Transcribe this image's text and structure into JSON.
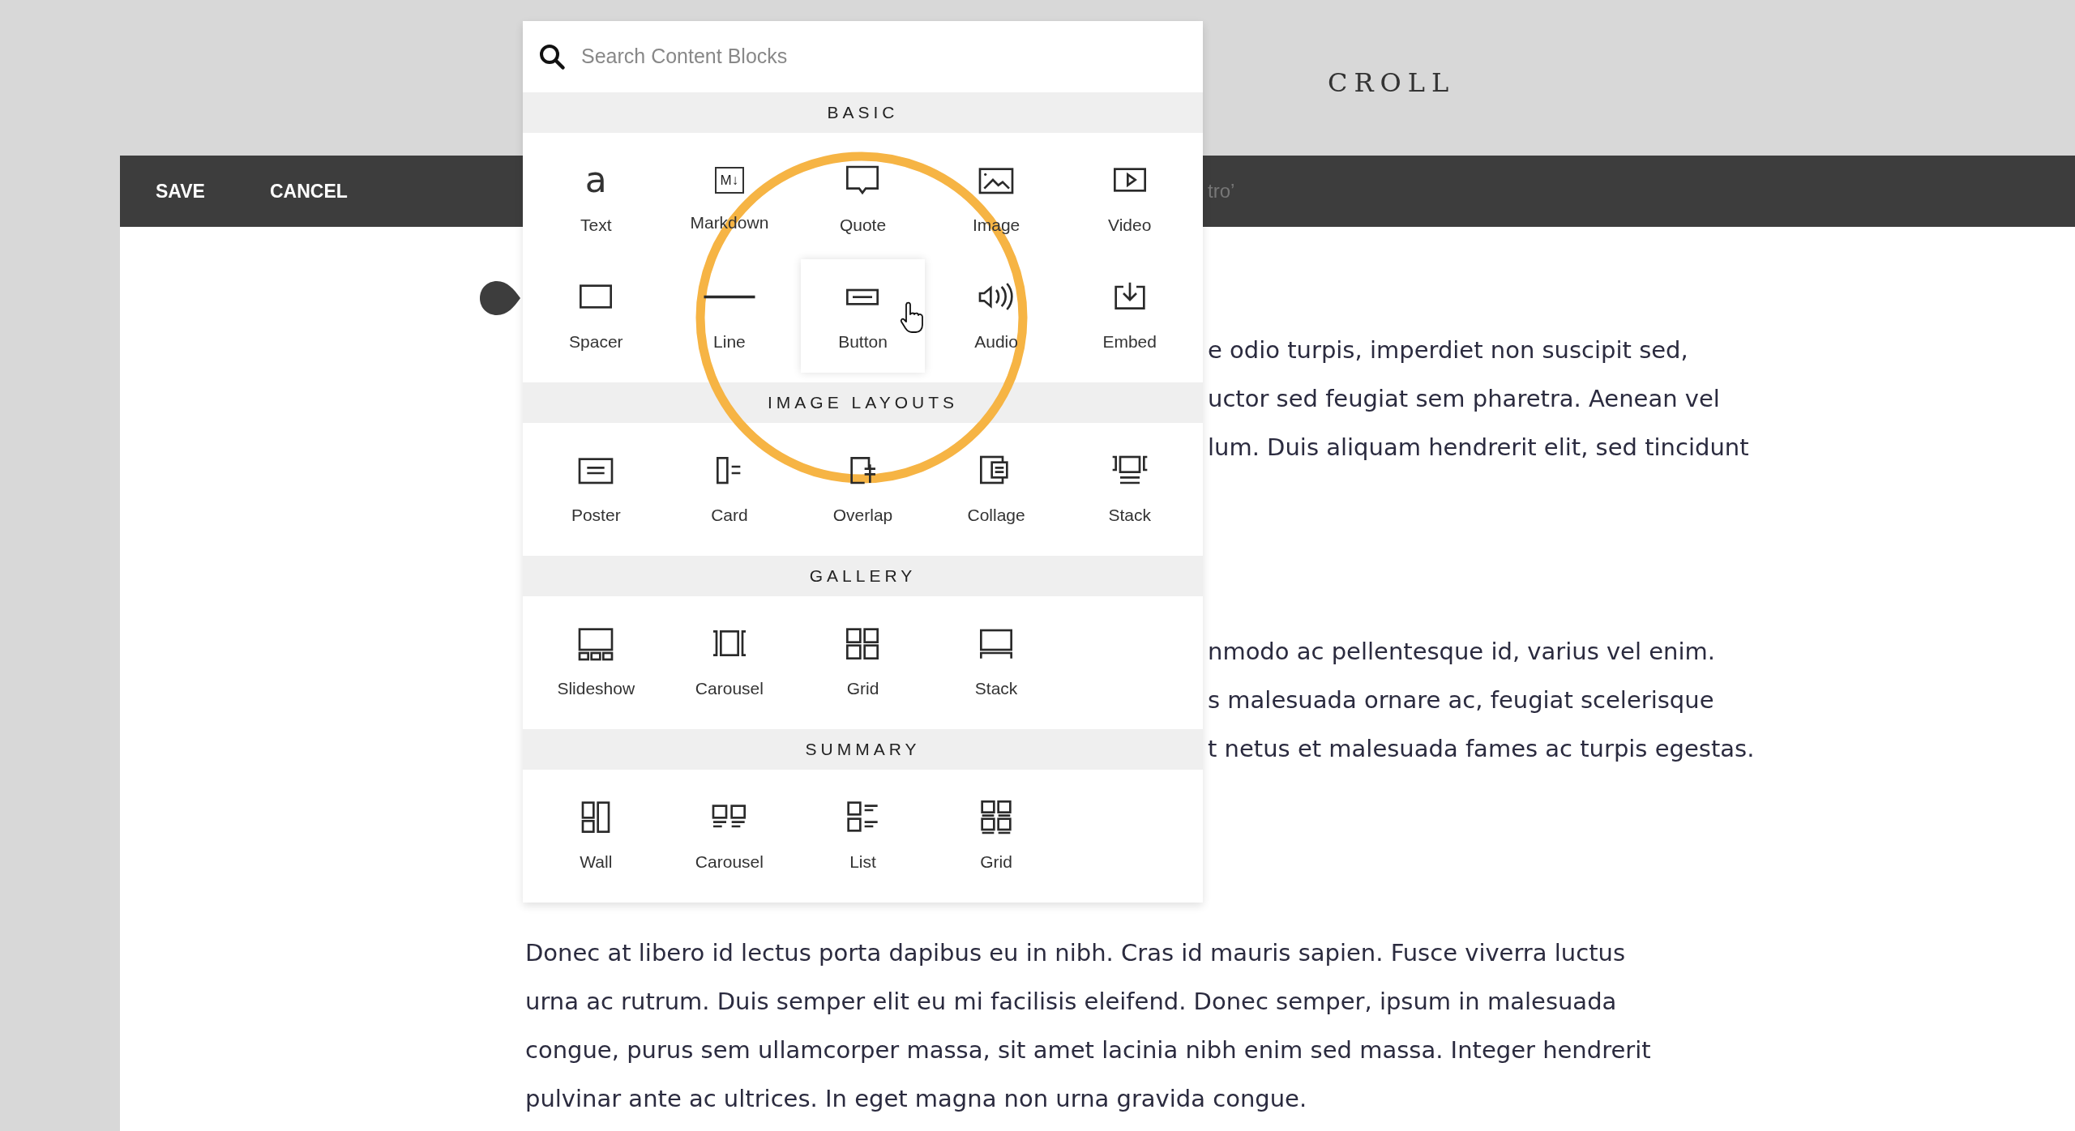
{
  "header": {
    "logo": "CROLL"
  },
  "toolbar": {
    "buttons": [
      "SAVE",
      "CANCEL"
    ],
    "title_fragment": "tro’"
  },
  "block_menu": {
    "search": {
      "placeholder": "Search Content Blocks"
    },
    "sections": [
      {
        "title": "BASIC",
        "items": [
          {
            "label": "Text",
            "glyph": "a",
            "selected": false
          },
          {
            "label": "Markdown",
            "glyph": "M↓",
            "selected": false
          },
          {
            "label": "Quote",
            "selected": false
          },
          {
            "label": "Image",
            "selected": false
          },
          {
            "label": "Video",
            "selected": false
          },
          {
            "label": "Spacer",
            "selected": false
          },
          {
            "label": "Line",
            "selected": false
          },
          {
            "label": "Button",
            "selected": true
          },
          {
            "label": "Audio",
            "selected": false
          },
          {
            "label": "Embed",
            "selected": false
          }
        ]
      },
      {
        "title": "IMAGE LAYOUTS",
        "items": [
          {
            "label": "Poster",
            "selected": false
          },
          {
            "label": "Card",
            "selected": false
          },
          {
            "label": "Overlap",
            "selected": false
          },
          {
            "label": "Collage",
            "selected": false
          },
          {
            "label": "Stack",
            "selected": false
          }
        ]
      },
      {
        "title": "GALLERY",
        "items": [
          {
            "label": "Slideshow",
            "selected": false
          },
          {
            "label": "Carousel",
            "selected": false
          },
          {
            "label": "Grid",
            "selected": false
          },
          {
            "label": "Stack",
            "selected": false
          }
        ]
      },
      {
        "title": "SUMMARY",
        "items": [
          {
            "label": "Wall",
            "selected": false
          },
          {
            "label": "Carousel",
            "selected": false
          },
          {
            "label": "List",
            "selected": false
          },
          {
            "label": "Grid",
            "selected": false
          }
        ]
      }
    ]
  },
  "paragraphs": [
    {
      "lines": [
        "e odio turpis, imperdiet non suscipit sed,",
        "uctor sed feugiat sem pharetra. Aenean vel",
        "lum. Duis aliquam hendrerit elit, sed tincidunt"
      ],
      "partial": true
    },
    {
      "lines": [
        "nmodo ac pellentesque id, varius vel enim.",
        "s malesuada ornare ac, feugiat scelerisque",
        "t netus et malesuada fames ac turpis egestas."
      ],
      "partial": true
    },
    {
      "lines": [
        "Donec at libero id lectus porta dapibus eu in nibh. Cras id mauris sapien. Fusce viverra luctus",
        "urna ac rutrum. Duis semper elit eu mi facilisis eleifend. Donec semper, ipsum in malesuada",
        "congue, purus sem ullamcorper massa, sit amet lacinia nibh enim sed massa. Integer hendrerit",
        "pulvinar ante ac ultrices. In eget magna non urna gravida congue."
      ],
      "partial": false
    }
  ]
}
